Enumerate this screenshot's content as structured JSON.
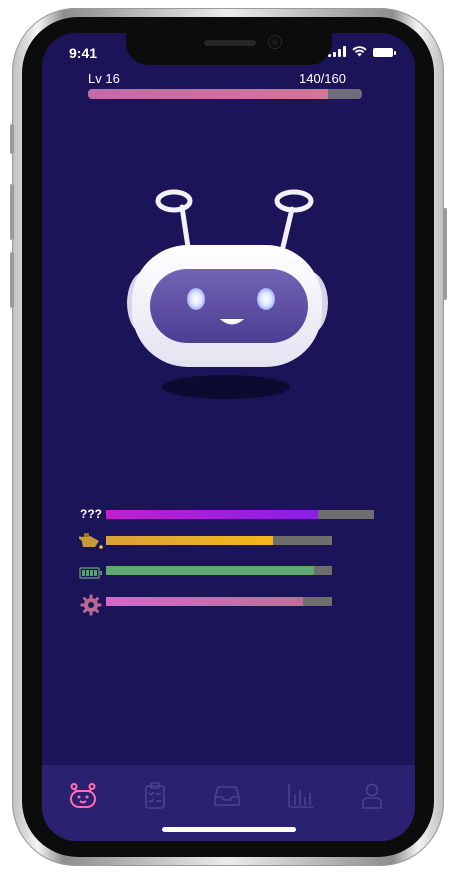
{
  "status_bar": {
    "time": "9:41",
    "signal_icon": "cellular-signal-icon",
    "wifi_icon": "wifi-icon",
    "battery_icon": "battery-icon"
  },
  "level": {
    "label": "Lv 16",
    "xp_text": "140/160",
    "xp_current": 140,
    "xp_max": 160
  },
  "robot": {
    "icon": "robot-mascot"
  },
  "stats": [
    {
      "icon": "mystery-icon",
      "icon_text": "???",
      "value_fraction": 0.79,
      "color": "#b01ad8"
    },
    {
      "icon": "oil-can-icon",
      "icon_text": "",
      "value_fraction": 0.74,
      "color": "#f4b81a"
    },
    {
      "icon": "battery-level-icon",
      "icon_text": "",
      "value_fraction": 0.92,
      "color": "#5fa872"
    },
    {
      "icon": "gear-icon",
      "icon_text": "",
      "value_fraction": 0.87,
      "color": "#d866c8"
    }
  ],
  "colors": {
    "background": "#1b1459",
    "tabbar": "#2a2270",
    "active_tab": "#ff6fae",
    "inactive_tab": "#4a4391",
    "xp_fill": "#d27696"
  },
  "tabbar": {
    "tabs": [
      {
        "icon": "robot-tab-icon",
        "active": true
      },
      {
        "icon": "clipboard-tasks-icon",
        "active": false
      },
      {
        "icon": "inbox-tray-icon",
        "active": false
      },
      {
        "icon": "bar-chart-icon",
        "active": false
      },
      {
        "icon": "user-profile-icon",
        "active": false
      }
    ]
  }
}
